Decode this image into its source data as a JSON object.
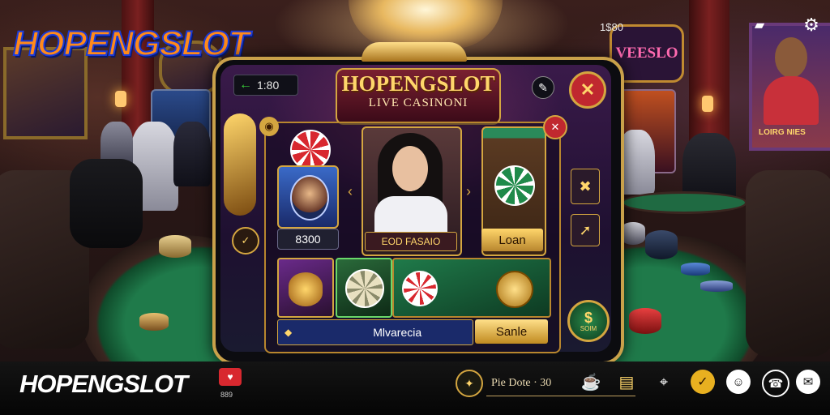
{
  "brand": {
    "logo_text": "HOPENGSLOT",
    "footer_logo_text": "HOPENGSLOT"
  },
  "top_right": {
    "counter": "1$80"
  },
  "wall_sign": {
    "text": "VEESLO"
  },
  "poster": {
    "text": "LOIRG NIES"
  },
  "tablet": {
    "balance": "1:80",
    "app_title": "HOPENGSLOT",
    "app_subtitle": "LIVE CASINONI",
    "player_card_value": "8300",
    "dealer_label": "EOD FASAIO",
    "loan_button": "Loan",
    "bottom_field": "Mlvarecia",
    "gold_button": "Sanle",
    "round_chip_label": "SOIM"
  },
  "bottom_bar": {
    "status_text": "Pie Dote · 30",
    "badge_text": "889"
  },
  "colors": {
    "accent_gold": "#d4a640",
    "felt_green": "#1f7a4a",
    "close_red": "#c0282f"
  }
}
